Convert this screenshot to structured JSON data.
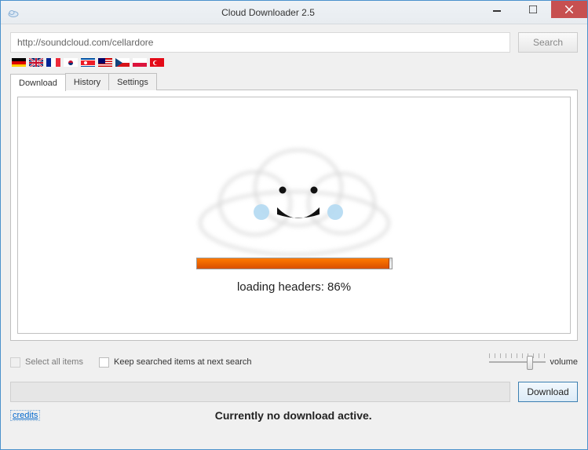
{
  "window": {
    "title": "Cloud Downloader 2.5"
  },
  "search": {
    "url": "http://soundcloud.com/cellardore",
    "button": "Search"
  },
  "flags": [
    "de",
    "gb",
    "fr",
    "kr",
    "kp",
    "my",
    "cz",
    "pl",
    "tr"
  ],
  "tabs": {
    "download": "Download",
    "history": "History",
    "settings": "Settings"
  },
  "loading": {
    "text": "loading headers: 86%",
    "percent": 86
  },
  "options": {
    "select_all": "Select all items",
    "keep_searched": "Keep searched items at next search",
    "volume_label": "volume"
  },
  "actions": {
    "download": "Download",
    "credits": "credits"
  },
  "status": "Currently no download active."
}
